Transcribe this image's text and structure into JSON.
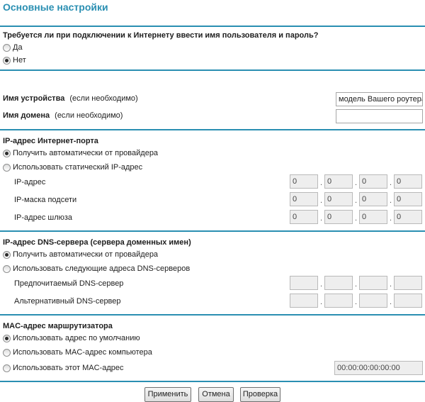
{
  "page_title": "Основные настройки",
  "login": {
    "question": "Требуется ли при подключении к Интернету ввести имя пользователя и пароль?",
    "options": [
      {
        "label": "Да",
        "checked": false
      },
      {
        "label": "Нет",
        "checked": true
      }
    ]
  },
  "device": {
    "name_label": "Имя устройства",
    "name_hint": "(если необходимо)",
    "name_value": "модель Вашего роутера",
    "domain_label": "Имя домена",
    "domain_hint": "(если необходимо)",
    "domain_value": ""
  },
  "internet_ip": {
    "section_title": "IP-адрес Интернет-порта",
    "options": [
      {
        "label": "Получить автоматически от провайдера",
        "checked": true
      },
      {
        "label": "Использовать статический IP-адрес",
        "checked": false
      }
    ],
    "fields": [
      {
        "label": "IP-адрес",
        "octets": [
          "0",
          "0",
          "0",
          "0"
        ]
      },
      {
        "label": "IP-маска подсети",
        "octets": [
          "0",
          "0",
          "0",
          "0"
        ]
      },
      {
        "label": "IP-адрес шлюза",
        "octets": [
          "0",
          "0",
          "0",
          "0"
        ]
      }
    ]
  },
  "dns": {
    "section_title": "IP-адрес DNS-сервера (сервера доменных имен)",
    "options": [
      {
        "label": "Получить автоматически от провайдера",
        "checked": true
      },
      {
        "label": "Использовать следующие адреса DNS-серверов",
        "checked": false
      }
    ],
    "fields": [
      {
        "label": "Предпочитаемый DNS-сервер",
        "octets": [
          "",
          "",
          "",
          ""
        ]
      },
      {
        "label": "Альтернативный DNS-сервер",
        "octets": [
          "",
          "",
          "",
          ""
        ]
      }
    ]
  },
  "mac": {
    "section_title": "MAC-адрес маршрутизатора",
    "options": [
      {
        "label": "Использовать адрес по умолчанию",
        "checked": true
      },
      {
        "label": "Использовать MAC-адрес компьютера",
        "checked": false
      },
      {
        "label": "Использовать этот MAC-адрес",
        "checked": false
      }
    ],
    "value": "00:00:00:00:00:00"
  },
  "buttons": {
    "apply": "Применить",
    "cancel": "Отмена",
    "test": "Проверка"
  },
  "colors": {
    "accent": "#2a8fb2"
  }
}
